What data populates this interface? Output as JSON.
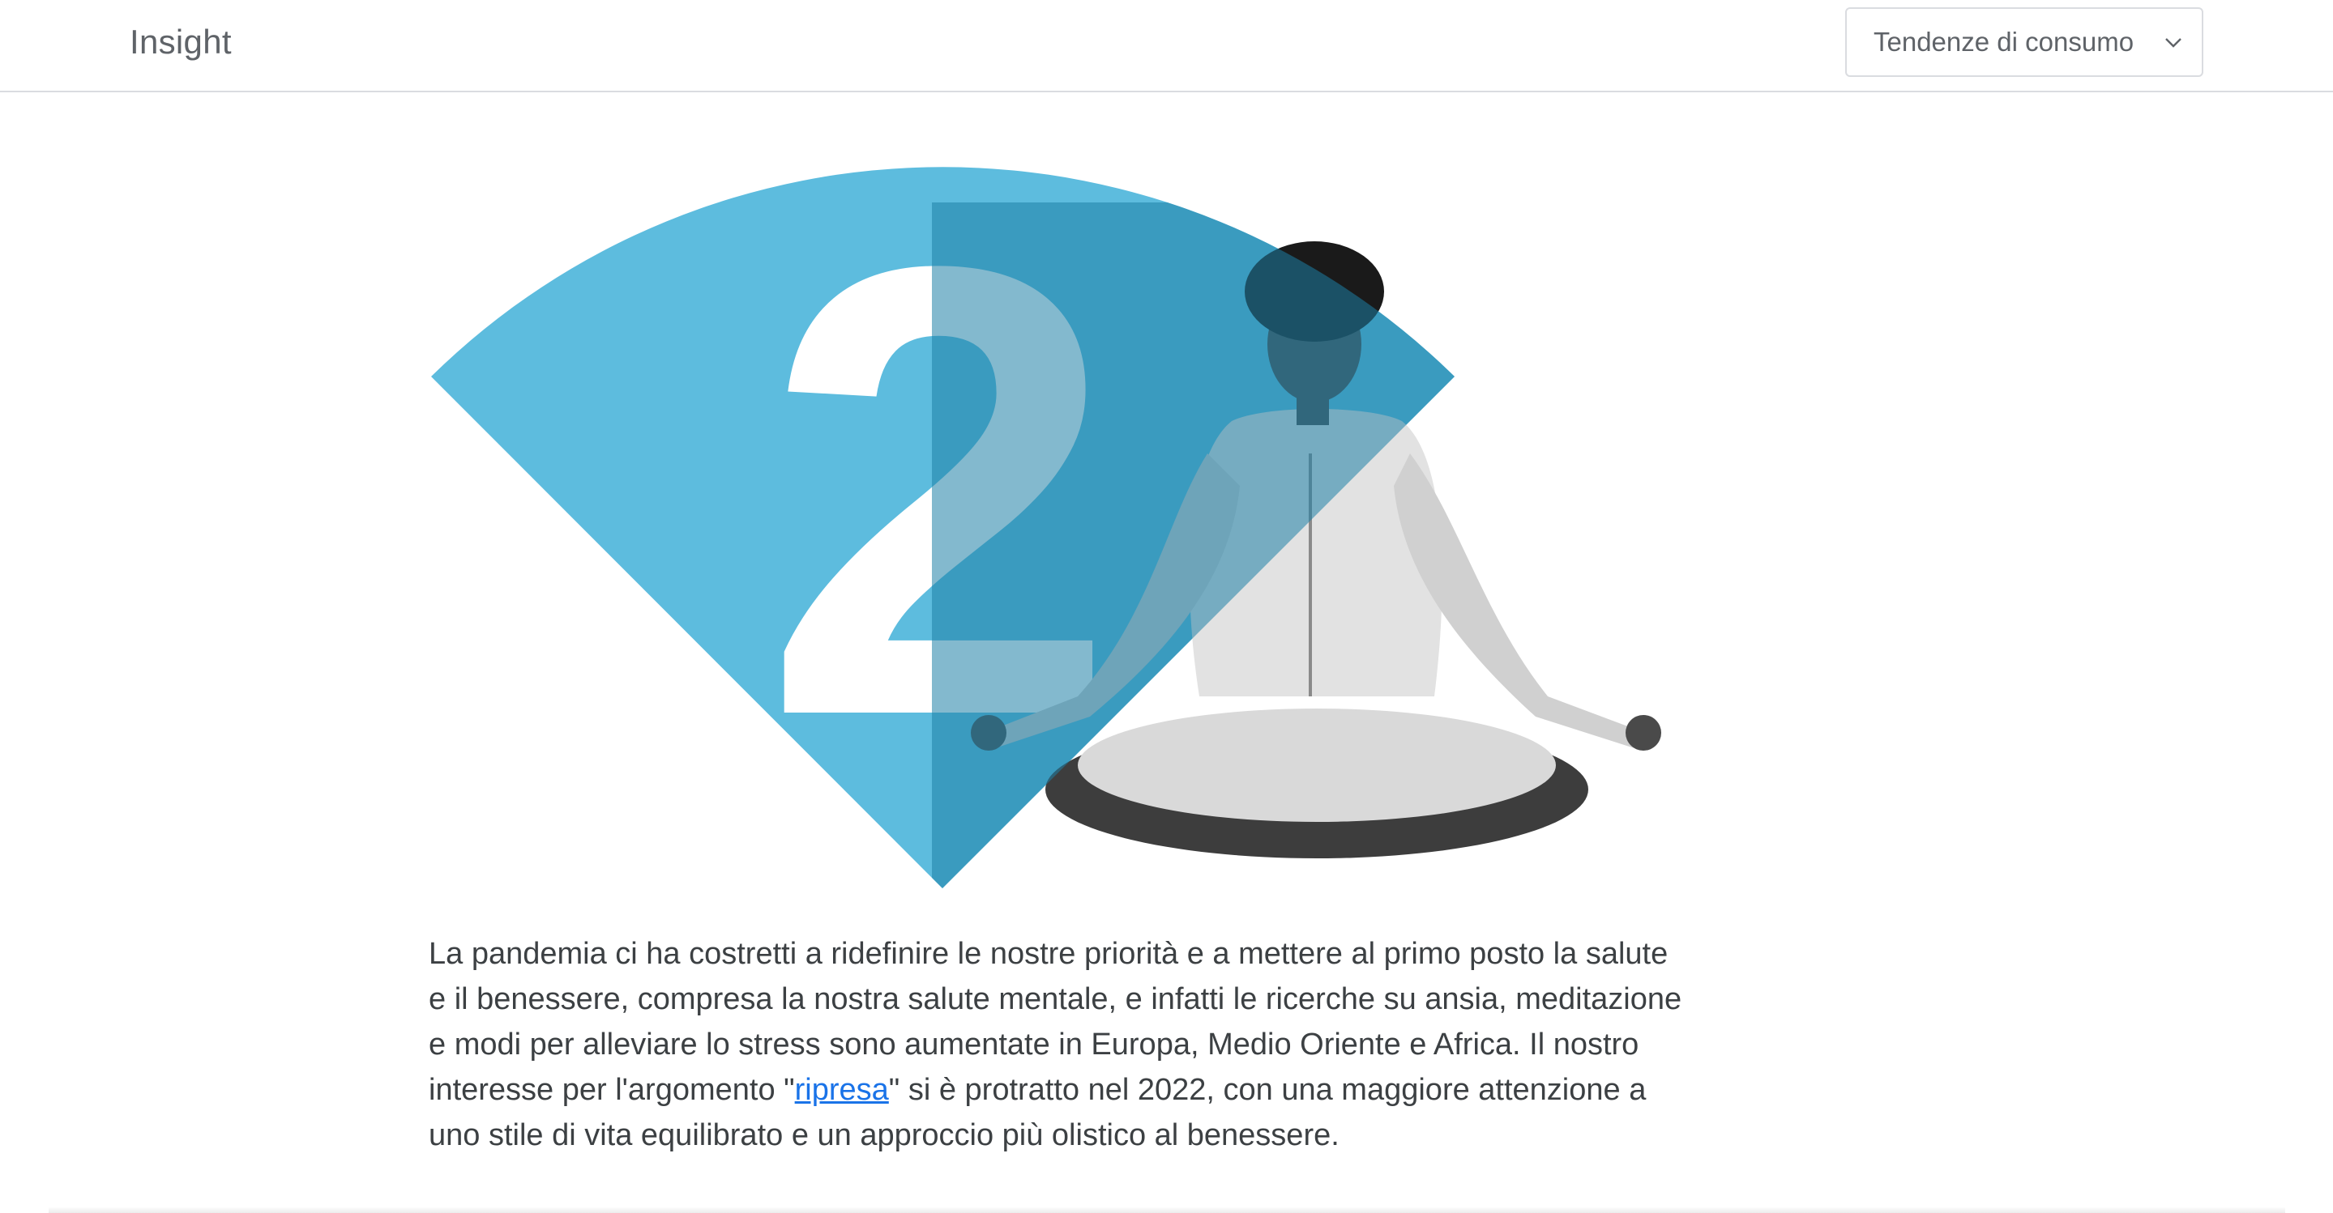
{
  "header": {
    "brand": "Insight",
    "category_select": {
      "selected": "Tendenze di consumo",
      "icon": "chevron-down-icon"
    }
  },
  "hero": {
    "number": "2",
    "accent_color": "#5dbcde",
    "image_subject": "person-meditating-figure"
  },
  "article": {
    "text_before_link": "La pandemia ci ha costretti a ridefinire le nostre priorità e a mettere al primo posto la salute e il benessere, compresa la nostra salute mentale, e infatti le ricerche su ansia, meditazione e modi per alleviare lo stress sono aumentate in Europa, Medio Oriente e Africa. Il nostro interesse per l'argomento \"",
    "link_text": "ripresa",
    "text_after_link": "\" si è protratto nel 2022, con una maggiore attenzione a uno stile di vita equilibrato e un approccio più olistico al benessere."
  }
}
